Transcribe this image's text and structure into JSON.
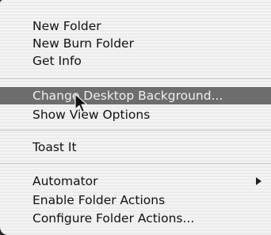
{
  "menu": {
    "items": [
      {
        "label": "New Folder"
      },
      {
        "label": "New Burn Folder"
      },
      {
        "label": "Get Info"
      },
      {
        "label": "Change Desktop Background..."
      },
      {
        "label": "Show View Options"
      },
      {
        "label": "Toast It"
      },
      {
        "label": "Automator"
      },
      {
        "label": "Enable Folder Actions"
      },
      {
        "label": "Configure Folder Actions..."
      }
    ],
    "highlighted_item": "Change Desktop Background...",
    "icons": {
      "submenu_arrow": "chevron-right-icon",
      "cursor": "arrow-cursor-icon"
    }
  }
}
